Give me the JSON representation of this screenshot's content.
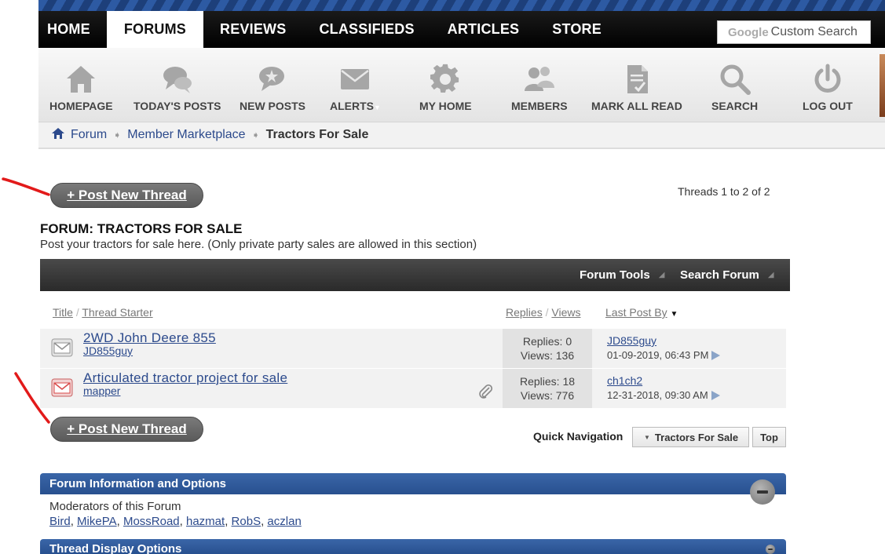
{
  "nav": {
    "tabs": [
      {
        "label": "HOME"
      },
      {
        "label": "FORUMS"
      },
      {
        "label": "REVIEWS"
      },
      {
        "label": "CLASSIFIEDS"
      },
      {
        "label": "ARTICLES"
      },
      {
        "label": "STORE"
      }
    ],
    "active_tab": "FORUMS",
    "search_brand": "Google",
    "search_placeholder": "Custom Search"
  },
  "iconbar": {
    "items": [
      {
        "label": "HOMEPAGE",
        "icon": "house-icon"
      },
      {
        "label": "TODAY'S POSTS",
        "icon": "chat-bubbles-icon"
      },
      {
        "label": "NEW POSTS",
        "icon": "chat-star-icon"
      },
      {
        "label": "ALERTS",
        "icon": "envelope-icon"
      },
      {
        "label": "MY HOME",
        "icon": "gear-icon"
      },
      {
        "label": "MEMBERS",
        "icon": "people-icon"
      },
      {
        "label": "MARK ALL READ",
        "icon": "document-check-icon"
      },
      {
        "label": "SEARCH",
        "icon": "magnifier-icon"
      },
      {
        "label": "LOG OUT",
        "icon": "power-icon"
      }
    ]
  },
  "breadcrumb": {
    "items": [
      "Forum",
      "Member Marketplace"
    ],
    "current": "Tractors For Sale"
  },
  "post_button_label": "+ Post New Thread",
  "thread_count": "Threads 1 to 2 of 2",
  "forum": {
    "title": "FORUM: TRACTORS FOR SALE",
    "description": "Post your tractors for sale here. (Only private party sales are allowed in this section)"
  },
  "toolbar": {
    "forum_tools": "Forum Tools",
    "search_forum": "Search Forum"
  },
  "columns": {
    "title": "Title",
    "sep": "/",
    "thread_starter": "Thread Starter",
    "replies": "Replies",
    "views": "Views",
    "last_post_by": "Last Post By"
  },
  "threads": [
    {
      "title": "2WD John Deere 855",
      "starter": "JD855guy",
      "replies": "Replies: 0",
      "views": "Views: 136",
      "last_user": "JD855guy",
      "last_date": "01-09-2019,",
      "last_time": "06:43 PM",
      "status_color": "#909090"
    },
    {
      "title": "Articulated tractor project for sale",
      "starter": "mapper",
      "replies": "Replies: 18",
      "views": "Views: 776",
      "last_user": "ch1ch2",
      "last_date": "12-31-2018,",
      "last_time": "09:30 AM",
      "status_color": "#d84a4a"
    }
  ],
  "quick_nav": {
    "label": "Quick Navigation",
    "selected": "Tractors For Sale",
    "top": "Top"
  },
  "info_panel": {
    "title": "Forum Information and Options",
    "moderators_label": "Moderators of this Forum",
    "moderators": [
      "Bird",
      "MikePA",
      "MossRoad",
      "hazmat",
      "RobS",
      "aczlan"
    ]
  },
  "display_panel": {
    "title": "Thread Display Options"
  }
}
